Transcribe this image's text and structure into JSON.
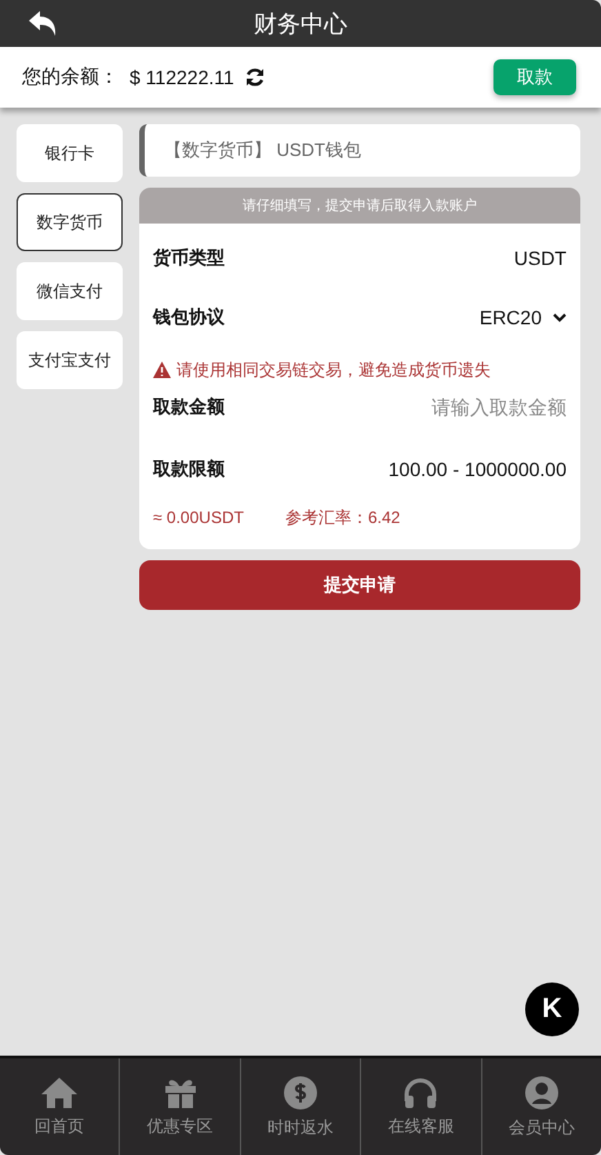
{
  "header": {
    "title": "财务中心"
  },
  "balance": {
    "label": "您的余额：",
    "amount": "$ 112222.11",
    "withdraw_button": "取款"
  },
  "methods": [
    {
      "label": "银行卡",
      "selected": false
    },
    {
      "label": "数字货币",
      "selected": true
    },
    {
      "label": "微信支付",
      "selected": false
    },
    {
      "label": "支付宝支付",
      "selected": false
    }
  ],
  "wallet_title": "【数字货币】 USDT钱包",
  "form": {
    "notice": "请仔细填写，提交申请后取得入款账户",
    "currency_type": {
      "label": "货币类型",
      "value": "USDT"
    },
    "protocol": {
      "label": "钱包协议",
      "value": "ERC20"
    },
    "warning": "请使用相同交易链交易，避免造成货币遗失",
    "amount": {
      "label": "取款金额",
      "placeholder": "请输入取款金额"
    },
    "limit": {
      "label": "取款限额",
      "value": "100.00 - 1000000.00"
    },
    "converted": "≈ 0.00USDT",
    "rate": "参考汇率：6.42"
  },
  "submit_button": "提交申请",
  "float_button": "K",
  "nav": [
    {
      "label": "回首页"
    },
    {
      "label": "优惠专区"
    },
    {
      "label": "时时返水"
    },
    {
      "label": "在线客服"
    },
    {
      "label": "会员中心"
    }
  ]
}
